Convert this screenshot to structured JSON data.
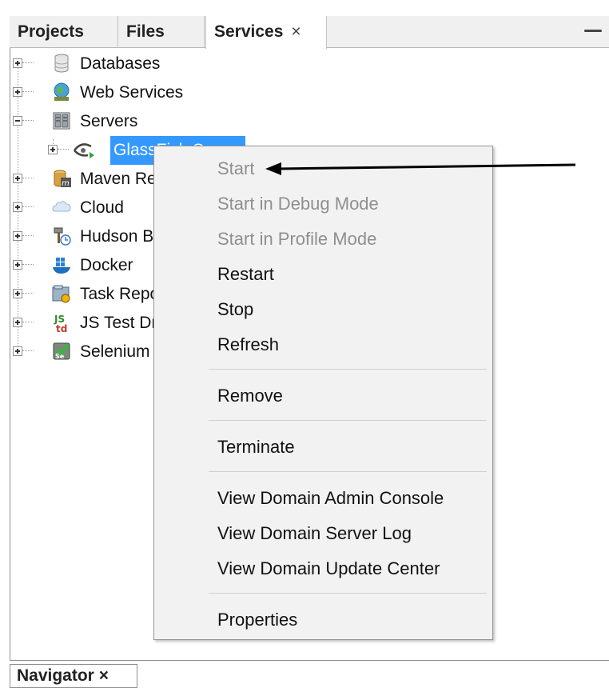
{
  "tabs": {
    "projects": "Projects",
    "files": "Files",
    "services": "Services",
    "close_glyph": "×",
    "minimize_glyph": "—"
  },
  "tree": {
    "items": [
      {
        "label": "Databases",
        "icon": "database-icon"
      },
      {
        "label": "Web Services",
        "icon": "web-services-icon"
      },
      {
        "label": "Servers",
        "icon": "servers-icon"
      },
      {
        "label": "GlassFish Server",
        "icon": "glassfish-icon",
        "selected": true
      },
      {
        "label": "Maven Repositories",
        "icon": "maven-icon"
      },
      {
        "label": "Cloud",
        "icon": "cloud-icon"
      },
      {
        "label": "Hudson Builders",
        "icon": "hudson-icon"
      },
      {
        "label": "Docker",
        "icon": "docker-icon"
      },
      {
        "label": "Task Repositories",
        "icon": "task-repository-icon"
      },
      {
        "label": "JS Test Driver",
        "icon": "js-test-driver-icon"
      },
      {
        "label": "Selenium Server",
        "icon": "selenium-icon"
      }
    ]
  },
  "context_menu": {
    "items": [
      {
        "label": "Start",
        "enabled": false
      },
      {
        "label": "Start in Debug Mode",
        "enabled": false
      },
      {
        "label": "Start in Profile Mode",
        "enabled": false
      },
      {
        "label": "Restart",
        "enabled": true
      },
      {
        "label": "Stop",
        "enabled": true
      },
      {
        "label": "Refresh",
        "enabled": true
      },
      {
        "label": "Remove",
        "enabled": true
      },
      {
        "label": "Terminate",
        "enabled": true
      },
      {
        "label": "View Domain Admin Console",
        "enabled": true
      },
      {
        "label": "View Domain Server Log",
        "enabled": true
      },
      {
        "label": "View Domain Update Center",
        "enabled": true
      },
      {
        "label": "Properties",
        "enabled": true
      }
    ]
  },
  "bottom_tab": "Navigator ×",
  "colors": {
    "selection": "#3399ff",
    "menu_background": "#f2f2f2",
    "disabled_text": "#8f8f8f"
  }
}
